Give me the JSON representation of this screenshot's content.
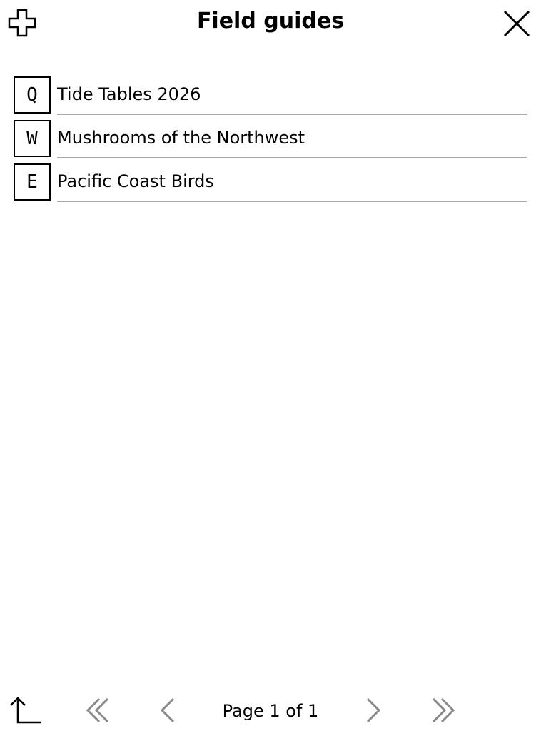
{
  "header": {
    "title": "Field guides",
    "add_icon": "plus-outline-icon",
    "close_icon": "close-x-icon"
  },
  "items": [
    {
      "key": "Q",
      "label": "Tide Tables 2026"
    },
    {
      "key": "W",
      "label": "Mushrooms of the Northwest"
    },
    {
      "key": "E",
      "label": "Pacific Coast Birds"
    }
  ],
  "footer": {
    "page_label": "Page 1 of 1",
    "icons": {
      "up": "go-up-icon",
      "first": "double-chevron-left-icon",
      "prev": "chevron-left-icon",
      "next": "chevron-right-icon",
      "last": "double-chevron-right-icon"
    }
  },
  "colors": {
    "text": "#000000",
    "divider": "#a8a8a8",
    "disabled_arrow": "#8a8a8a",
    "background": "#ffffff"
  }
}
